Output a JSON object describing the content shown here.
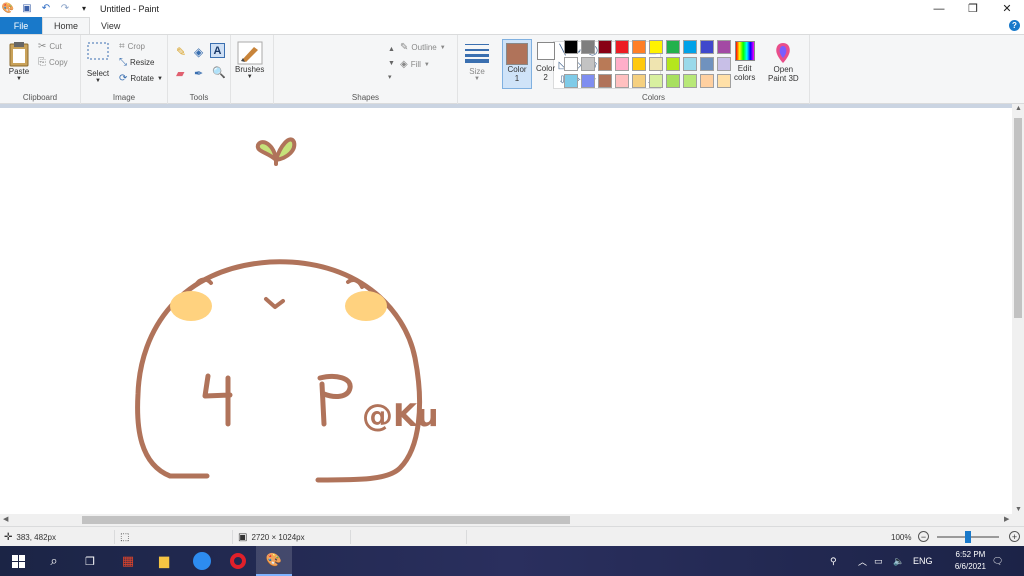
{
  "window": {
    "title": "Untitled - Paint"
  },
  "tabs": [
    {
      "label": "File"
    },
    {
      "label": "Home"
    },
    {
      "label": "View"
    }
  ],
  "ribbon": {
    "clipboard": {
      "label": "Clipboard",
      "paste": "Paste",
      "cut": "Cut",
      "copy": "Copy"
    },
    "image": {
      "label": "Image",
      "select": "Select",
      "crop": "Crop",
      "resize": "Resize",
      "rotate": "Rotate"
    },
    "tools": {
      "label": "Tools"
    },
    "brushes": {
      "label": "Brushes"
    },
    "shapes": {
      "label": "Shapes",
      "outline": "Outline",
      "fill": "Fill"
    },
    "size": {
      "label": "Size"
    },
    "colors": {
      "label": "Colors",
      "color1": "Color",
      "color1_num": "1",
      "color2": "Color",
      "color2_num": "2",
      "color1_value": "#b0735a",
      "color2_value": "#ffffff",
      "edit": "Edit",
      "edit2": "colors",
      "palette": [
        "#000000",
        "#7f7f7f",
        "#880015",
        "#ed1c24",
        "#ff7f27",
        "#fff200",
        "#22b14c",
        "#00a2e8",
        "#3f48cc",
        "#a349a4",
        "#ffffff",
        "#c3c3c3",
        "#b97a57",
        "#ffaec9",
        "#ffc90e",
        "#efe4b0",
        "#b5e61d",
        "#99d9ea",
        "#7092be",
        "#c8bfe7",
        "#7fcbe8",
        "#7f8ef0",
        "#b0735a",
        "#ffc0c0",
        "#f5d080",
        "#d8f0a0",
        "#a8e060",
        "#b8e878",
        "#ffd0a0",
        "#ffe0a8"
      ]
    },
    "paint3d": {
      "label1": "Open",
      "label2": "Paint 3D"
    }
  },
  "canvas": {
    "stroke_color": "#b0735a",
    "blush_color": "#ffd27f",
    "sprout_color": "#c6e27a",
    "signature": "@Ku"
  },
  "status": {
    "cursor": "383, 482px",
    "canvas_size": "2720 × 1024px",
    "zoom": "100%"
  },
  "taskbar": {
    "lang": "ENG",
    "time": "6:52 PM",
    "date": "6/6/2021"
  }
}
